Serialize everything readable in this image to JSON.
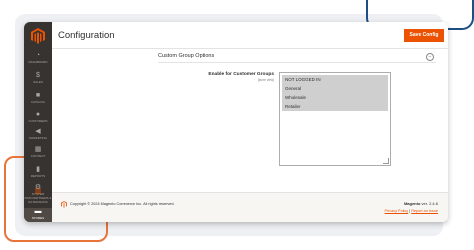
{
  "page": {
    "title": "Configuration",
    "save_label": "Save Config"
  },
  "sidebar": {
    "items": [
      {
        "label": "DASHBOARD",
        "icon": "dashboard-icon"
      },
      {
        "label": "SALES",
        "icon": "dollar-icon"
      },
      {
        "label": "CATALOG",
        "icon": "box-icon"
      },
      {
        "label": "CUSTOMERS",
        "icon": "person-icon"
      },
      {
        "label": "MARKETING",
        "icon": "megaphone-icon"
      },
      {
        "label": "CONTENT",
        "icon": "content-icon"
      },
      {
        "label": "REPORTS",
        "icon": "bar-chart-icon"
      },
      {
        "label": "SYSTEM",
        "icon": "gear-icon"
      },
      {
        "label": "FIND PARTNERS & EXTENSIONS",
        "icon": "blocks-icon"
      },
      {
        "label": "STORES",
        "icon": "store-icon"
      }
    ]
  },
  "section": {
    "title": "Custom Group Options",
    "collapse_icon": "collapse-icon"
  },
  "field": {
    "label": "Enable for Customer Groups",
    "scope": "[store view]",
    "options": [
      "NOT LOGGED IN",
      "General",
      "Wholesale",
      "Retailer"
    ]
  },
  "footer": {
    "copyright": "Copyright © 2024 Magento Commerce Inc. All rights reserved.",
    "product": "Magento",
    "version": "ver. 2.4.6",
    "privacy": "Privacy Policy",
    "separator": "|",
    "report": "Report an Issue"
  },
  "colors": {
    "accent": "#eb5202",
    "sidebar_bg": "#373330",
    "deco_blue": "#1c4f86",
    "deco_orange": "#e8743b"
  }
}
